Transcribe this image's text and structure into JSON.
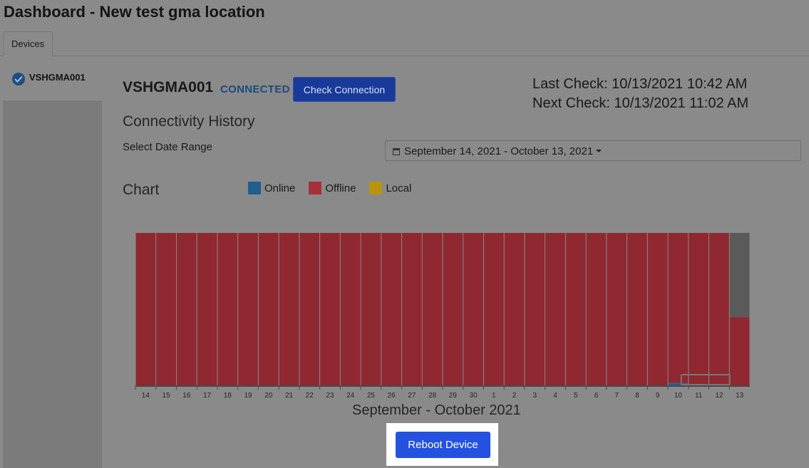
{
  "page": {
    "title": "Dashboard - New test gma location"
  },
  "tabs": [
    {
      "label": "Devices"
    }
  ],
  "sidebar": {
    "items": [
      {
        "label": "VSHGMA001"
      }
    ]
  },
  "device": {
    "name": "VSHGMA001",
    "status": "CONNECTED",
    "check_button": "Check Connection",
    "last_check": "Last Check: 10/13/2021 10:42 AM",
    "next_check": "Next Check: 10/13/2021 11:02 AM"
  },
  "history": {
    "title": "Connectivity History",
    "range_label": "Select Date Range",
    "range_value": "September 14, 2021 - October 13, 2021"
  },
  "chart_section": {
    "title": "Chart"
  },
  "colors": {
    "online": "#1f5f8f",
    "offline": "#8f2830",
    "local": "#b8940d",
    "nodata": "#5a5a5a"
  },
  "chart_data": {
    "type": "bar",
    "stacked": true,
    "xlabel": "September - October 2021",
    "categories": [
      "14",
      "15",
      "16",
      "17",
      "18",
      "19",
      "20",
      "21",
      "22",
      "23",
      "24",
      "25",
      "26",
      "27",
      "28",
      "29",
      "30",
      "1",
      "2",
      "3",
      "4",
      "5",
      "6",
      "7",
      "8",
      "9",
      "10",
      "11",
      "12",
      "13"
    ],
    "legend": [
      "Online",
      "Offline",
      "Local"
    ],
    "series": [
      {
        "name": "Online",
        "values": [
          0,
          0,
          0,
          0,
          0,
          0,
          0,
          0,
          0,
          0,
          0,
          0,
          0,
          0,
          0,
          0,
          0,
          0,
          0,
          0,
          0,
          0,
          0,
          0,
          0,
          0,
          0.02,
          0,
          0,
          0
        ]
      },
      {
        "name": "Offline",
        "values": [
          1,
          1,
          1,
          1,
          1,
          1,
          1,
          1,
          1,
          1,
          1,
          1,
          1,
          1,
          1,
          1,
          1,
          1,
          1,
          1,
          1,
          1,
          1,
          1,
          1,
          1,
          0.98,
          1,
          1,
          0.45
        ]
      },
      {
        "name": "Local",
        "values": [
          0,
          0,
          0,
          0,
          0,
          0,
          0,
          0,
          0,
          0,
          0,
          0,
          0,
          0,
          0,
          0,
          0,
          0,
          0,
          0,
          0,
          0,
          0,
          0,
          0,
          0,
          0,
          0,
          0,
          0
        ]
      }
    ],
    "ylim": [
      0,
      1
    ]
  },
  "actions": {
    "reboot": "Reboot Device"
  }
}
